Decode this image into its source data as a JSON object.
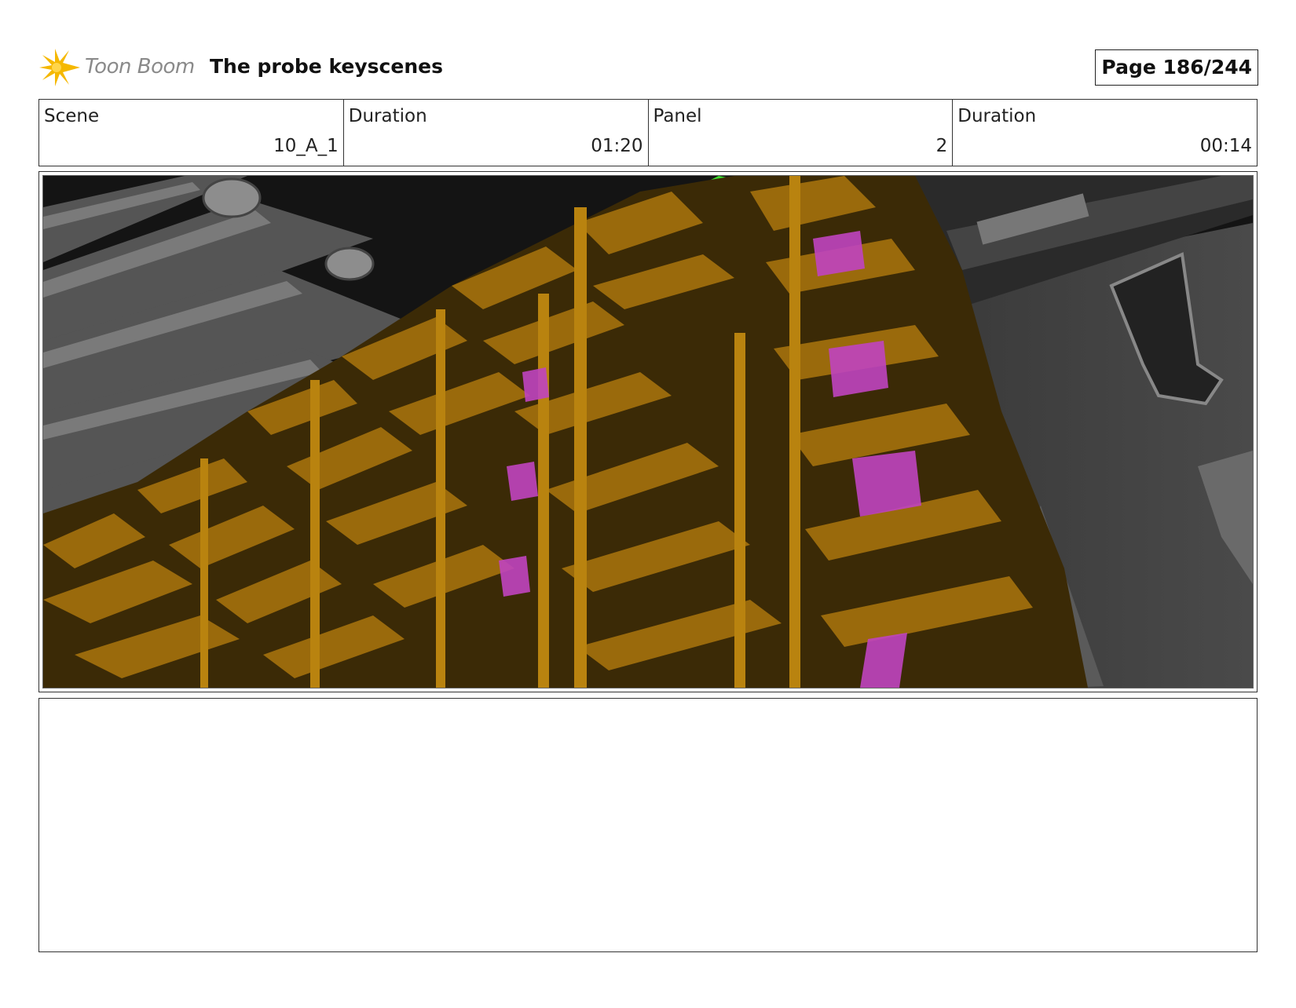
{
  "header": {
    "brand_name": "Toon Boom",
    "document_title": "The probe keyscenes",
    "page_label": "Page 186/244"
  },
  "info": {
    "scene_label": "Scene",
    "scene_value": "10_A_1",
    "scene_duration_label": "Duration",
    "scene_duration_value": "01:20",
    "panel_label": "Panel",
    "panel_value": "2",
    "panel_duration_label": "Duration",
    "panel_duration_value": "00:14"
  },
  "notes": {
    "text": ""
  },
  "colors": {
    "brand_accent": "#f5b800",
    "crate_gold": "#9a6a0c",
    "crate_dark": "#3b2a06",
    "highlight_magenta": "#c044c0",
    "highlight_green": "#3ddc2f"
  }
}
